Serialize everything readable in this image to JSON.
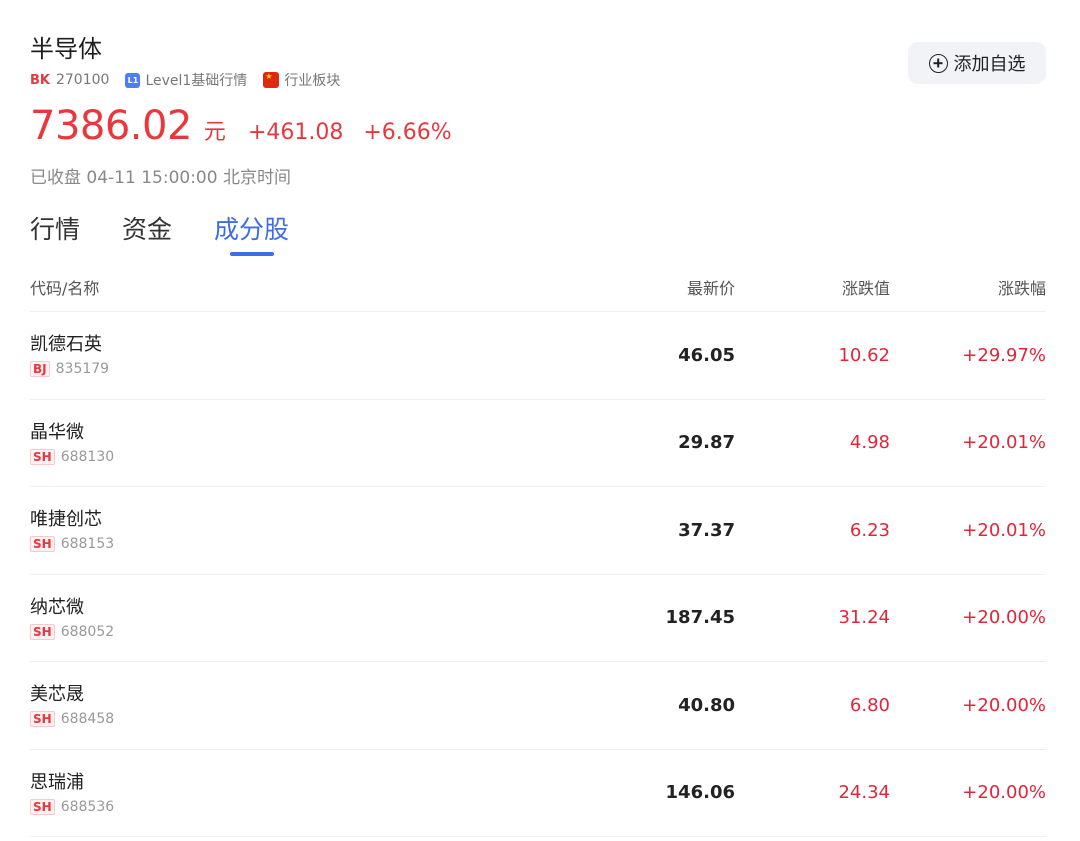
{
  "header": {
    "title": "半导体",
    "market_badge": "BK",
    "code": "270100",
    "level_icon_text": "L1",
    "level_label": "Level1基础行情",
    "sector_label": "行业板块",
    "add_button_label": "添加自选"
  },
  "quote": {
    "price": "7386.02",
    "unit": "元",
    "change": "+461.08",
    "change_pct": "+6.66%",
    "status": "已收盘 04-11 15:00:00 北京时间"
  },
  "tabs": [
    {
      "label": "行情",
      "active": false
    },
    {
      "label": "资金",
      "active": false
    },
    {
      "label": "成分股",
      "active": true
    }
  ],
  "table": {
    "headers": {
      "name": "代码/名称",
      "price": "最新价",
      "change": "涨跌值",
      "change_pct": "涨跌幅"
    },
    "rows": [
      {
        "name": "凯德石英",
        "exchange": "BJ",
        "code": "835179",
        "price": "46.05",
        "change": "10.62",
        "change_pct": "+29.97%"
      },
      {
        "name": "晶华微",
        "exchange": "SH",
        "code": "688130",
        "price": "29.87",
        "change": "4.98",
        "change_pct": "+20.01%"
      },
      {
        "name": "唯捷创芯",
        "exchange": "SH",
        "code": "688153",
        "price": "37.37",
        "change": "6.23",
        "change_pct": "+20.01%"
      },
      {
        "name": "纳芯微",
        "exchange": "SH",
        "code": "688052",
        "price": "187.45",
        "change": "31.24",
        "change_pct": "+20.00%"
      },
      {
        "name": "美芯晟",
        "exchange": "SH",
        "code": "688458",
        "price": "40.80",
        "change": "6.80",
        "change_pct": "+20.00%"
      },
      {
        "name": "思瑞浦",
        "exchange": "SH",
        "code": "688536",
        "price": "146.06",
        "change": "24.34",
        "change_pct": "+20.00%"
      }
    ]
  },
  "colors": {
    "up": "#e8383d",
    "accent": "#3d6ee8"
  }
}
